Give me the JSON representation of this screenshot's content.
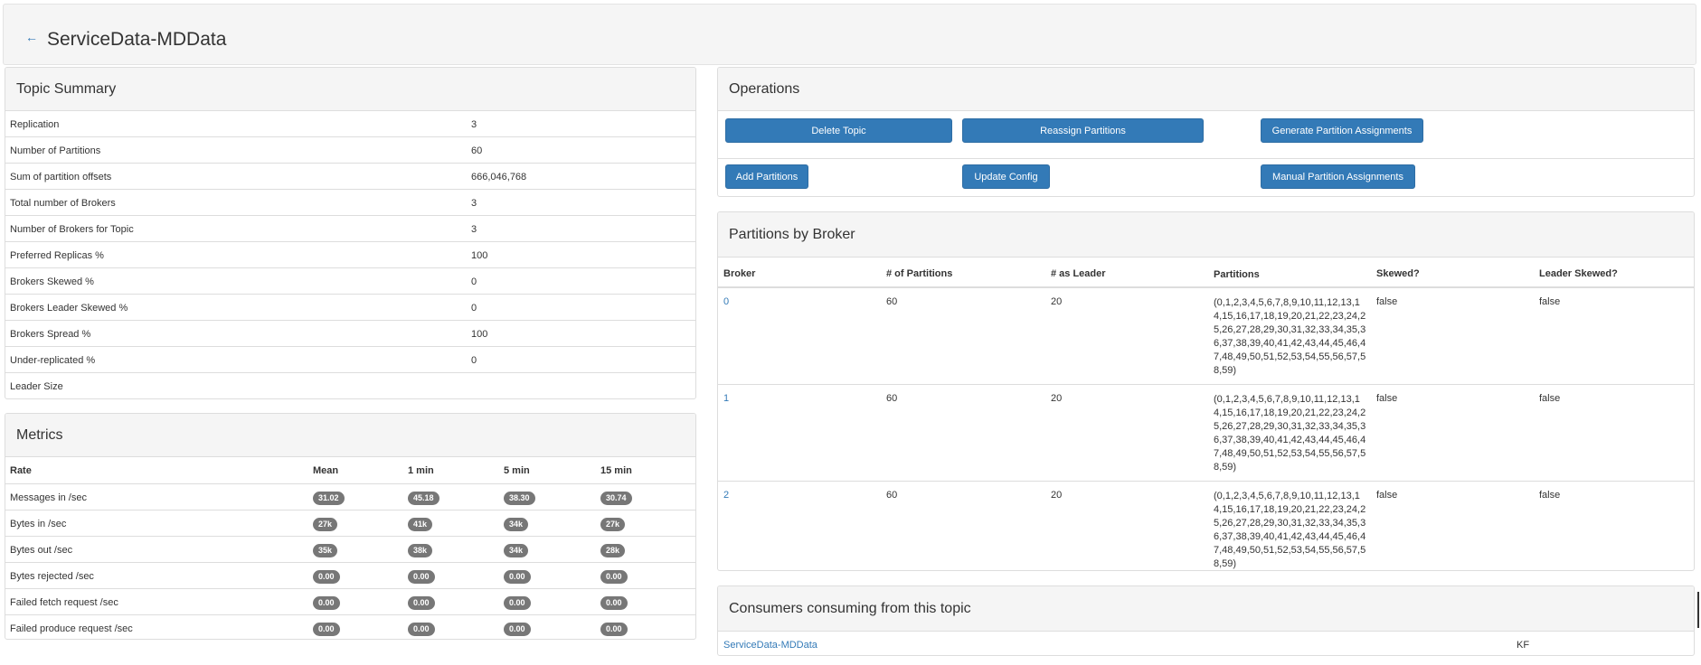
{
  "header": {
    "back_icon": "←",
    "title": "ServiceData-MDData"
  },
  "topic_summary": {
    "heading": "Topic Summary",
    "rows": [
      {
        "label": "Replication",
        "value": "3"
      },
      {
        "label": "Number of Partitions",
        "value": "60"
      },
      {
        "label": "Sum of partition offsets",
        "value": "666,046,768"
      },
      {
        "label": "Total number of Brokers",
        "value": "3"
      },
      {
        "label": "Number of Brokers for Topic",
        "value": "3"
      },
      {
        "label": "Preferred Replicas %",
        "value": "100"
      },
      {
        "label": "Brokers Skewed %",
        "value": "0"
      },
      {
        "label": "Brokers Leader Skewed %",
        "value": "0"
      },
      {
        "label": "Brokers Spread %",
        "value": "100"
      },
      {
        "label": "Under-replicated %",
        "value": "0"
      },
      {
        "label": "Leader Size",
        "value": ""
      }
    ]
  },
  "metrics": {
    "heading": "Metrics",
    "columns": [
      "Rate",
      "Mean",
      "1 min",
      "5 min",
      "15 min"
    ],
    "rows": [
      {
        "label": "Messages in /sec",
        "values": [
          "31.02",
          "45.18",
          "38.30",
          "30.74"
        ]
      },
      {
        "label": "Bytes in /sec",
        "values": [
          "27k",
          "41k",
          "34k",
          "27k"
        ]
      },
      {
        "label": "Bytes out /sec",
        "values": [
          "35k",
          "38k",
          "34k",
          "28k"
        ]
      },
      {
        "label": "Bytes rejected /sec",
        "values": [
          "0.00",
          "0.00",
          "0.00",
          "0.00"
        ]
      },
      {
        "label": "Failed fetch request /sec",
        "values": [
          "0.00",
          "0.00",
          "0.00",
          "0.00"
        ]
      },
      {
        "label": "Failed produce request /sec",
        "values": [
          "0.00",
          "0.00",
          "0.00",
          "0.00"
        ]
      }
    ]
  },
  "operations": {
    "heading": "Operations",
    "buttons": {
      "delete_topic": "Delete Topic",
      "reassign_partitions": "Reassign Partitions",
      "generate_partition_assignments": "Generate Partition Assignments",
      "add_partitions": "Add Partitions",
      "update_config": "Update Config",
      "manual_partition_assignments": "Manual Partition Assignments"
    }
  },
  "partitions_by_broker": {
    "heading": "Partitions by Broker",
    "columns": [
      "Broker",
      "# of Partitions",
      "# as Leader",
      "Partitions",
      "Skewed?",
      "Leader Skewed?"
    ],
    "rows": [
      {
        "broker": "0",
        "num_partitions": "60",
        "as_leader": "20",
        "partitions": "(0,1,2,3,4,5,6,7,8,9,10,11,12,13,14,15,16,17,18,19,20,21,22,23,24,25,26,27,28,29,30,31,32,33,34,35,36,37,38,39,40,41,42,43,44,45,46,47,48,49,50,51,52,53,54,55,56,57,58,59)",
        "skewed": "false",
        "leader_skewed": "false"
      },
      {
        "broker": "1",
        "num_partitions": "60",
        "as_leader": "20",
        "partitions": "(0,1,2,3,4,5,6,7,8,9,10,11,12,13,14,15,16,17,18,19,20,21,22,23,24,25,26,27,28,29,30,31,32,33,34,35,36,37,38,39,40,41,42,43,44,45,46,47,48,49,50,51,52,53,54,55,56,57,58,59)",
        "skewed": "false",
        "leader_skewed": "false"
      },
      {
        "broker": "2",
        "num_partitions": "60",
        "as_leader": "20",
        "partitions": "(0,1,2,3,4,5,6,7,8,9,10,11,12,13,14,15,16,17,18,19,20,21,22,23,24,25,26,27,28,29,30,31,32,33,34,35,36,37,38,39,40,41,42,43,44,45,46,47,48,49,50,51,52,53,54,55,56,57,58,59)",
        "skewed": "false",
        "leader_skewed": "false"
      }
    ]
  },
  "consumers": {
    "heading": "Consumers consuming from this topic",
    "rows": [
      {
        "name": "ServiceData-MDData",
        "type": "KF"
      }
    ]
  }
}
